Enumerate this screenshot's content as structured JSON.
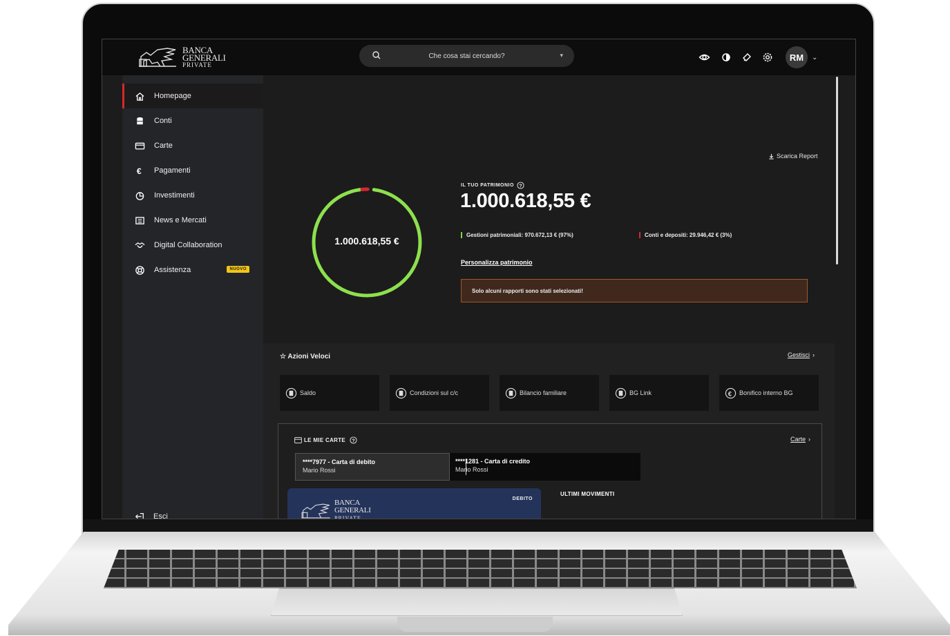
{
  "brand": {
    "line1": "BANCA",
    "line2": "GENERALI",
    "line3": "PRIVATE"
  },
  "search": {
    "placeholder": "Che cosa stai cercando?"
  },
  "user": {
    "initials": "RM"
  },
  "sidebar": {
    "items": [
      {
        "label": "Homepage",
        "icon": "home-icon"
      },
      {
        "label": "Conti",
        "icon": "database-icon"
      },
      {
        "label": "Carte",
        "icon": "credit-card-icon"
      },
      {
        "label": "Pagamenti",
        "icon": "euro-icon"
      },
      {
        "label": "Investimenti",
        "icon": "pie-chart-icon"
      },
      {
        "label": "News e Mercati",
        "icon": "newspaper-icon"
      },
      {
        "label": "Digital Collaboration",
        "icon": "handshake-icon"
      },
      {
        "label": "Assistenza",
        "icon": "lifebuoy-icon",
        "badge": "NUOVO"
      }
    ],
    "logout": "Esci"
  },
  "hero": {
    "report": "Scarica Report",
    "ring_total": "1.000.618,55 €",
    "label": "IL TUO PATRIMONIO",
    "total": "1.000.618,55 €",
    "legend_managed": "Gestioni patrimoniali: 970.672,13 € (97%)",
    "legend_deposits": "Conti e depositi: 29.946,42 € (3%)",
    "managed_share": 0.97,
    "deposits_share": 0.03,
    "personalize": "Personalizza patrimonio",
    "alert": "Solo alcuni rapporti sono stati selezionati!"
  },
  "quick": {
    "title": "Azioni Veloci",
    "manage": "Gestisci",
    "actions": [
      {
        "label": "Saldo"
      },
      {
        "label": "Condizioni sul c/c"
      },
      {
        "label": "Bilancio familiare"
      },
      {
        "label": "BG Link"
      },
      {
        "label": "Bonifico interno BG"
      }
    ]
  },
  "cards": {
    "title": "LE MIE CARTE",
    "link": "Carte",
    "tabs": [
      {
        "name": "****7977 - Carta di debito",
        "holder": "Mario Rossi"
      },
      {
        "name": "****1281 - Carta di credito",
        "holder": "Mario Rossi"
      }
    ],
    "card_type": "DEBITO",
    "movements_title": "ULTIMI MOVIMENTI"
  },
  "colors": {
    "accent_red": "#d8272d",
    "ring_green": "#8de04e",
    "alert_border": "#a0562a",
    "badge_yellow": "#f4c518"
  }
}
